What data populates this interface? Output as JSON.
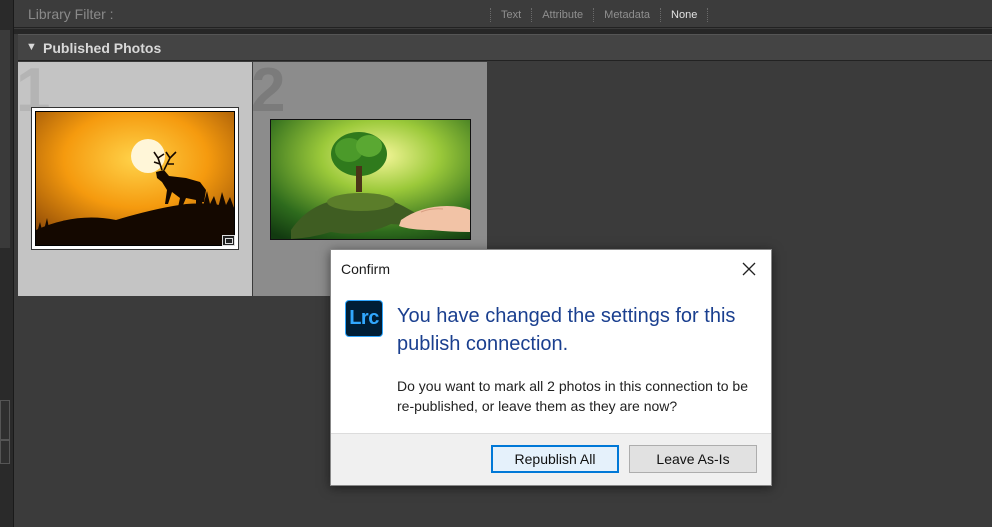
{
  "filter_bar": {
    "label": "Library Filter :",
    "options": [
      "Text",
      "Attribute",
      "Metadata",
      "None"
    ],
    "active": "None"
  },
  "section": {
    "title": "Published Photos",
    "toggle_icon": "triangle-down-icon"
  },
  "grid": {
    "cells": [
      {
        "number": "1",
        "subject": "deer silhouette at sunset",
        "selected": true
      },
      {
        "number": "2",
        "subject": "tree on hand held globe",
        "selected": false
      }
    ]
  },
  "dialog": {
    "title": "Confirm",
    "app_icon_text": "Lrc",
    "heading": "You have changed the settings for this publish connection.",
    "message": "Do you want to mark all 2 photos in this connection to be re-published, or leave them as they are now?",
    "buttons": {
      "primary": "Republish All",
      "secondary": "Leave As-Is"
    }
  },
  "colors": {
    "heading_blue": "#1a3f8f",
    "focus_blue": "#0078d7",
    "lrc_blue": "#31a8ff",
    "lrc_bg": "#001e36"
  }
}
